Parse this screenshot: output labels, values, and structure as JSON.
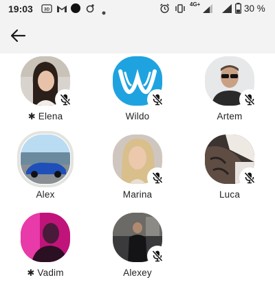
{
  "status_bar": {
    "time": "19:03",
    "battery_text": "30 %",
    "network_label": "4G+"
  },
  "header": {
    "back_icon": "arrow-left-icon"
  },
  "contacts": [
    {
      "name": "Elena",
      "starred": true,
      "muted": true,
      "avatar": "photo-woman-dark-hair"
    },
    {
      "name": "Wildo",
      "starred": false,
      "muted": true,
      "avatar": "logo-w-blue"
    },
    {
      "name": "Artem",
      "starred": false,
      "muted": true,
      "avatar": "photo-man-sunglasses"
    },
    {
      "name": "Alex",
      "starred": false,
      "muted": false,
      "avatar": "photo-blue-car"
    },
    {
      "name": "Marina",
      "starred": false,
      "muted": true,
      "avatar": "photo-woman-blonde"
    },
    {
      "name": "Luca",
      "starred": false,
      "muted": true,
      "avatar": "photo-tattooed-arm"
    },
    {
      "name": "Vadim",
      "starred": true,
      "muted": false,
      "avatar": "photo-pink-light"
    },
    {
      "name": "Alexey",
      "starred": false,
      "muted": true,
      "avatar": "photo-man-night"
    }
  ],
  "labels": {
    "c0": "Elena",
    "c1": "Wildo",
    "c2": "Artem",
    "c3": "Alex",
    "c4": "Marina",
    "c5": "Luca",
    "c6": "Vadim",
    "c7": "Alexey",
    "star": "✱"
  },
  "colors": {
    "accent_blue": "#1fa3e0",
    "ring_gray": "#e3e3df",
    "bar_bg": "#f3f3f3"
  }
}
